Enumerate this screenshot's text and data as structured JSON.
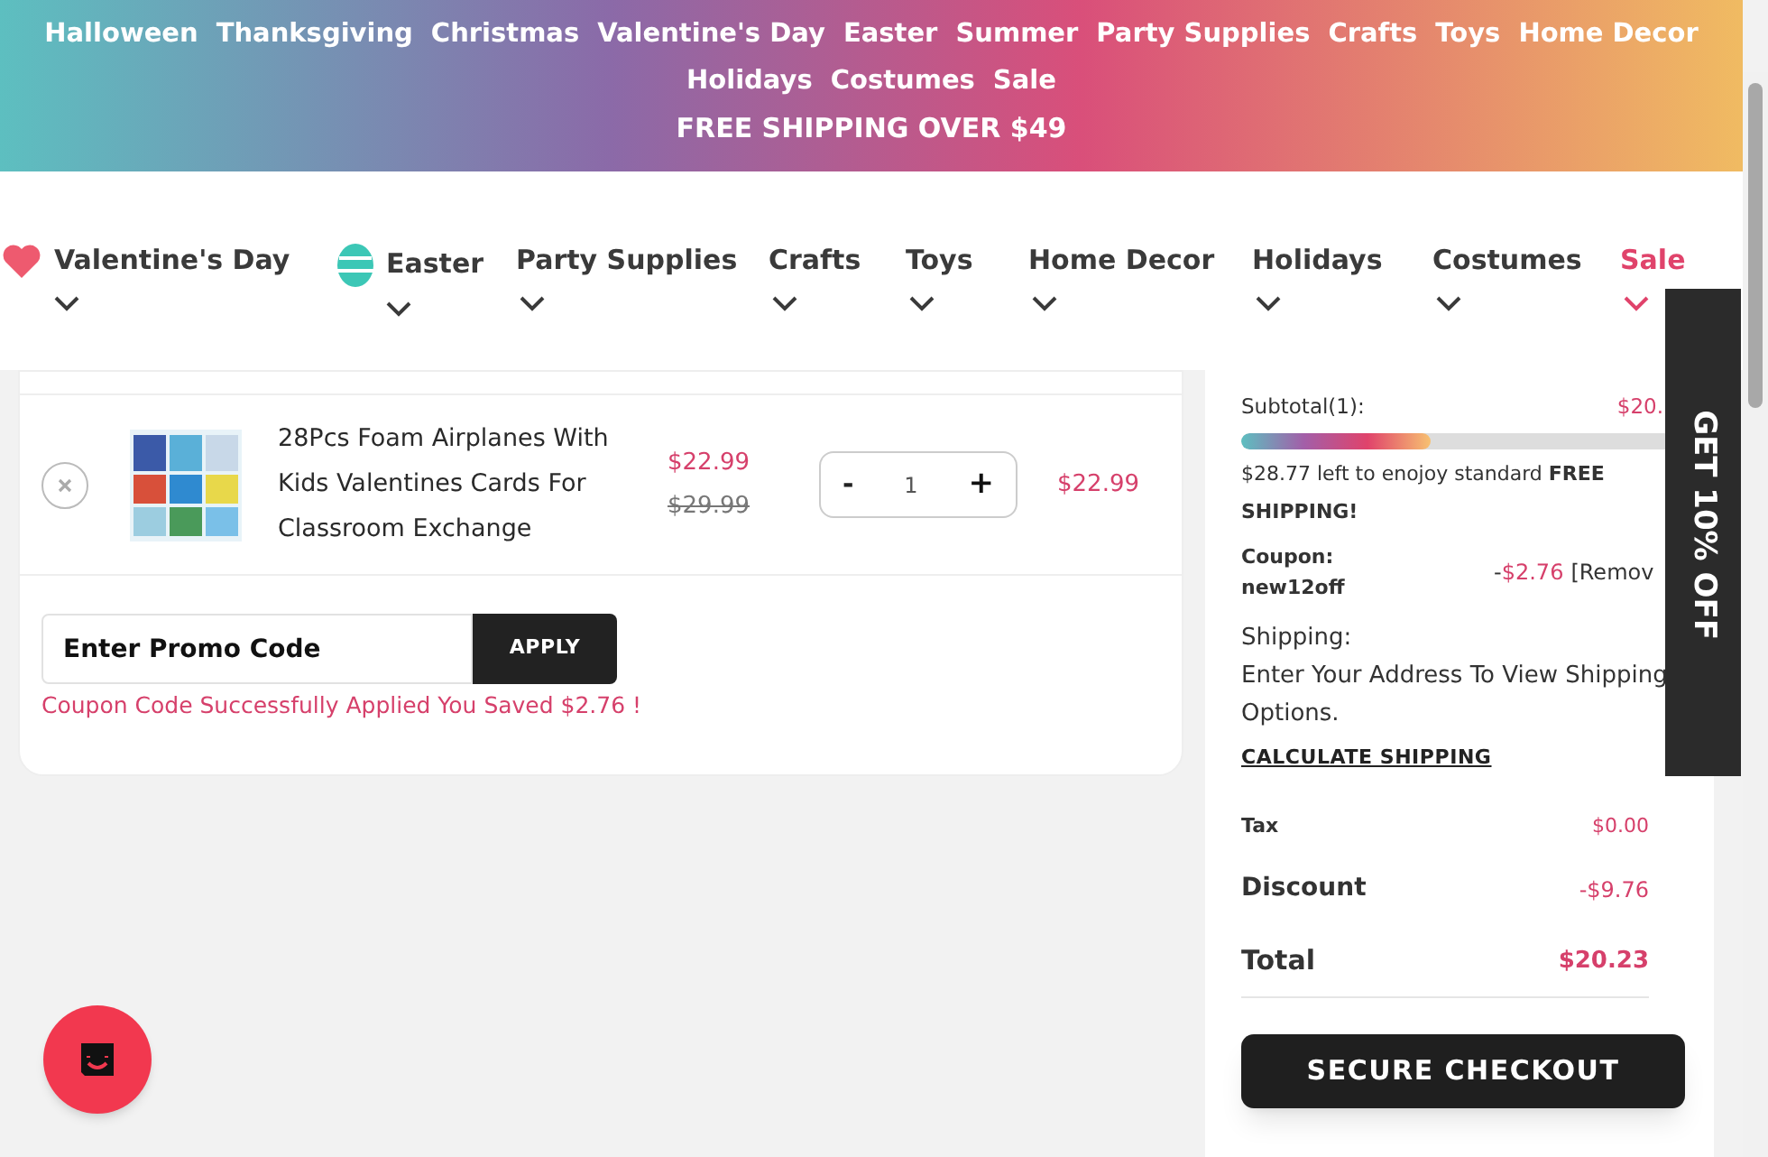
{
  "banner": {
    "links": [
      "Halloween",
      "Thanksgiving",
      "Christmas",
      "Valentine's Day",
      "Easter",
      "Summer",
      "Party Supplies",
      "Crafts",
      "Toys",
      "Home Decor",
      "Holidays",
      "Costumes",
      "Sale"
    ],
    "notice": "FREE SHIPPING OVER $49"
  },
  "nav": [
    {
      "label": "Valentine's Day",
      "kind": "heart",
      "highlight": false
    },
    {
      "label": "Easter",
      "kind": "egg",
      "highlight": false
    },
    {
      "label": "Party Supplies",
      "kind": "plain",
      "highlight": false
    },
    {
      "label": "Crafts",
      "kind": "plain",
      "highlight": false
    },
    {
      "label": "Toys",
      "kind": "plain",
      "highlight": false
    },
    {
      "label": "Home Decor",
      "kind": "plain",
      "highlight": false
    },
    {
      "label": "Holidays",
      "kind": "plain",
      "highlight": false
    },
    {
      "label": "Costumes",
      "kind": "plain",
      "highlight": false
    },
    {
      "label": "Sale",
      "kind": "plain",
      "highlight": true
    }
  ],
  "cart": {
    "items": [
      {
        "name": "28Pcs Foam Airplanes With Kids Valentines Cards For Classroom Exchange",
        "price": "$22.99",
        "old_price": "$29.99",
        "quantity": "1",
        "minus": "-",
        "plus": "+",
        "total": "$22.99"
      }
    ],
    "promo": {
      "placeholder": "Enter Promo Code",
      "button": "APPLY",
      "message": "Coupon Code Successfully Applied You Saved $2.76 !"
    }
  },
  "summary": {
    "subtotal_label": "Subtotal(1):",
    "subtotal_value": "$20.",
    "free_shipping": {
      "level": 0.42,
      "message": "$28.77 left to enojoy standard **FREE SHIPPING!**"
    },
    "coupon_label": "Coupon:",
    "coupon_code": "new12off",
    "coupon_sign": "-",
    "coupon_value": "$2.76",
    "coupon_remove": "[Remov",
    "shipping_label": "Shipping:",
    "shipping_text": "Enter Your Address To View Shipping Options.",
    "shipping_link": "CALCULATE SHIPPING",
    "tax_label": "Tax",
    "tax_value": "$0.00",
    "discount_label": "Discount",
    "discount_value": "-$9.76",
    "total_label": "Total",
    "total_value": "$20.23",
    "checkout": "SECURE CHECKOUT"
  },
  "promo_tab": "GET 10% OFF"
}
